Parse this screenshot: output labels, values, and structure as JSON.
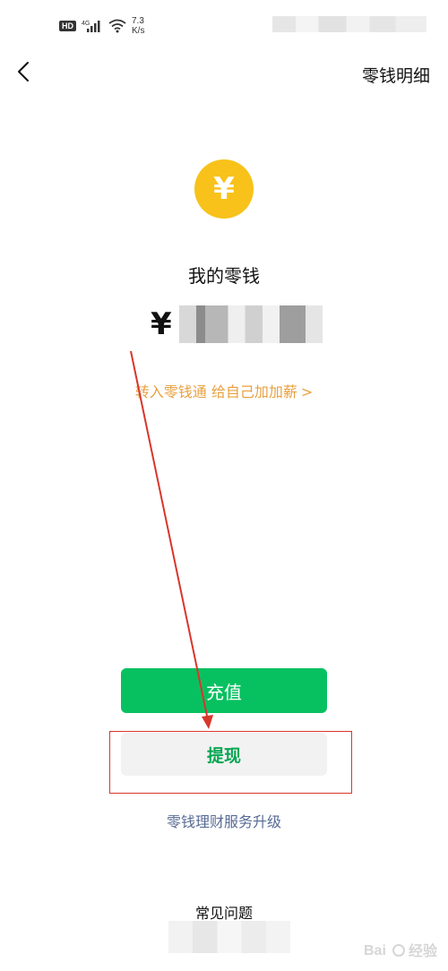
{
  "status_bar": {
    "hd_label": "HD",
    "signal_label": "4G",
    "net_speed_value": "7.3",
    "net_speed_unit": "K/s"
  },
  "nav": {
    "back_icon": "chevron-left-icon",
    "detail_label": "零钱明细"
  },
  "wallet": {
    "coin_icon": "yuan-coin-icon",
    "coin_symbol": "¥",
    "title": "我的零钱",
    "currency_symbol": "¥",
    "promo_label": "转入零钱通 给自己加加薪",
    "promo_chevron": ">"
  },
  "actions": {
    "recharge_label": "充值",
    "withdraw_label": "提现",
    "upgrade_label": "零钱理财服务升级",
    "faq_label": "常见问题"
  },
  "watermark": {
    "text": "经验"
  },
  "colors": {
    "brand_green": "#07c160",
    "coin_yellow": "#f8c21a",
    "promo_orange": "#e8a040",
    "link_blue": "#576b95",
    "annotation_red": "#d9362b"
  }
}
